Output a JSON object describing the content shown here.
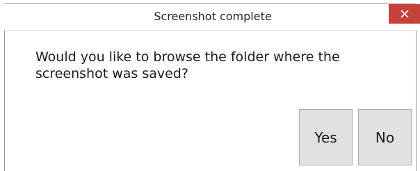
{
  "window": {
    "title": "Screenshot complete",
    "close_icon": "close-icon",
    "close_color": "#c7413b"
  },
  "dialog": {
    "message": "Would you like to browse the folder where the screenshot was saved?"
  },
  "buttons": {
    "yes_label": "Yes",
    "no_label": "No"
  }
}
